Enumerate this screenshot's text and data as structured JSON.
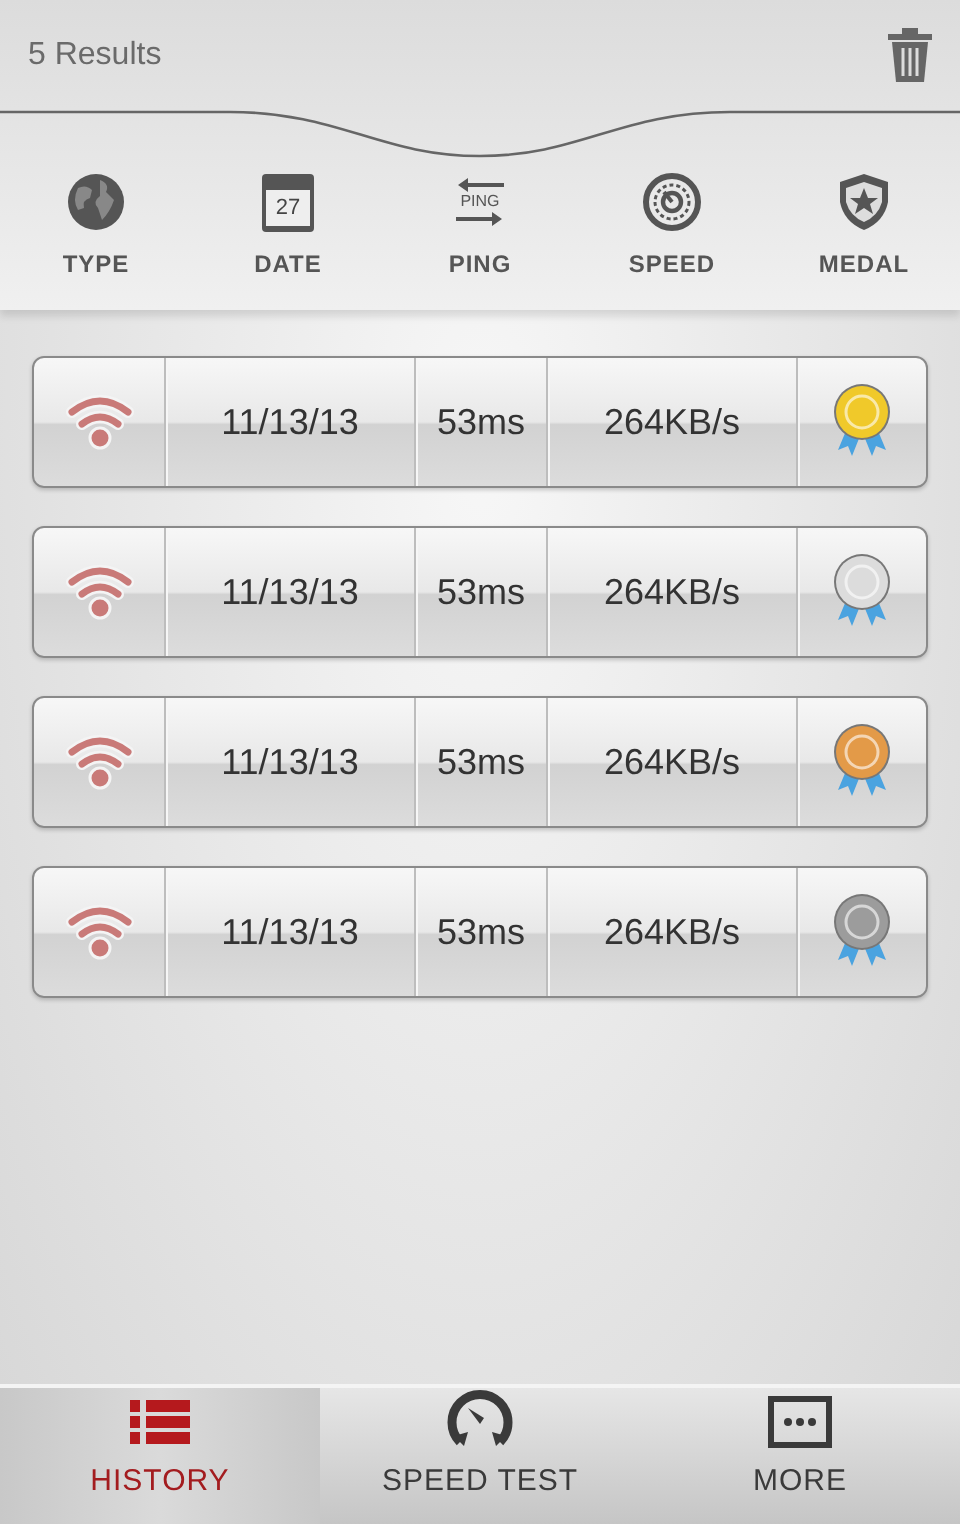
{
  "header": {
    "results": "5 Results"
  },
  "columns": [
    {
      "kind": "type",
      "label": "TYPE"
    },
    {
      "kind": "date",
      "label": "DATE",
      "icon_text": "27"
    },
    {
      "kind": "ping",
      "label": "PING",
      "icon_text": "PING"
    },
    {
      "kind": "speed",
      "label": "SPEED"
    },
    {
      "kind": "medal",
      "label": "MEDAL"
    }
  ],
  "results": [
    {
      "date": "11/13/13",
      "ping": "53ms",
      "speed": "264KB/s",
      "color": "#f0c92a"
    },
    {
      "date": "11/13/13",
      "ping": "53ms",
      "speed": "264KB/s",
      "color": "#dcdcdc"
    },
    {
      "date": "11/13/13",
      "ping": "53ms",
      "speed": "264KB/s",
      "color": "#e39a48"
    },
    {
      "date": "11/13/13",
      "ping": "53ms",
      "speed": "264KB/s",
      "color": "#9c9c9c"
    }
  ],
  "nav": [
    {
      "kind": "history",
      "label": "HISTORY",
      "selected": true
    },
    {
      "kind": "speed",
      "label": "SPEED TEST",
      "selected": false
    },
    {
      "kind": "more",
      "label": "MORE",
      "selected": false
    }
  ]
}
